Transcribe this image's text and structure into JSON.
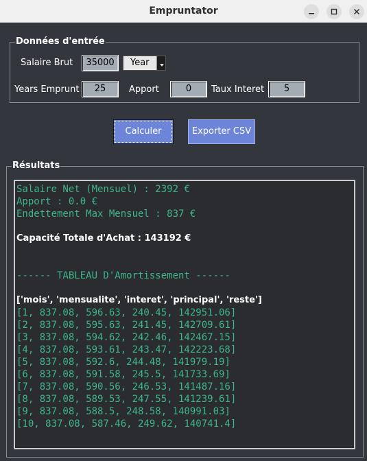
{
  "window": {
    "title": "Empruntator"
  },
  "input_group": {
    "legend": "Données d'entrée",
    "salaire_label": "Salaire Brut",
    "salaire_value": "35000",
    "period_selected": "Year",
    "years_label": "Years Emprunt",
    "years_value": "25",
    "apport_label": "Apport",
    "apport_value": "0",
    "taux_label": "Taux Interet",
    "taux_value": "5"
  },
  "actions": {
    "calculer": "Calculer",
    "exporter": "Exporter CSV"
  },
  "results": {
    "legend": "Résultats",
    "salaire_net": "Salaire Net (Mensuel) : 2392 €",
    "apport": "Apport : 0.0 €",
    "endettement": "Endettement Max Mensuel : 837 €",
    "capacite": "Capacité Totale d'Achat : 143192 €",
    "table_title": "------ TABLEAU D'Amortissement ------",
    "table_header": "['mois', 'mensualite', 'interet', 'principal', 'reste']",
    "rows": [
      "[1, 837.08, 596.63, 240.45, 142951.06]",
      "[2, 837.08, 595.63, 241.45, 142709.61]",
      "[3, 837.08, 594.62, 242.46, 142467.15]",
      "[4, 837.08, 593.61, 243.47, 142223.68]",
      "[5, 837.08, 592.6, 244.48, 141979.19]",
      "[6, 837.08, 591.58, 245.5, 141733.69]",
      "[7, 837.08, 590.56, 246.53, 141487.16]",
      "[8, 837.08, 589.53, 247.55, 141239.61]",
      "[9, 837.08, 588.5, 248.58, 140991.03]",
      "[10, 837.08, 587.46, 249.62, 140741.4]"
    ]
  }
}
